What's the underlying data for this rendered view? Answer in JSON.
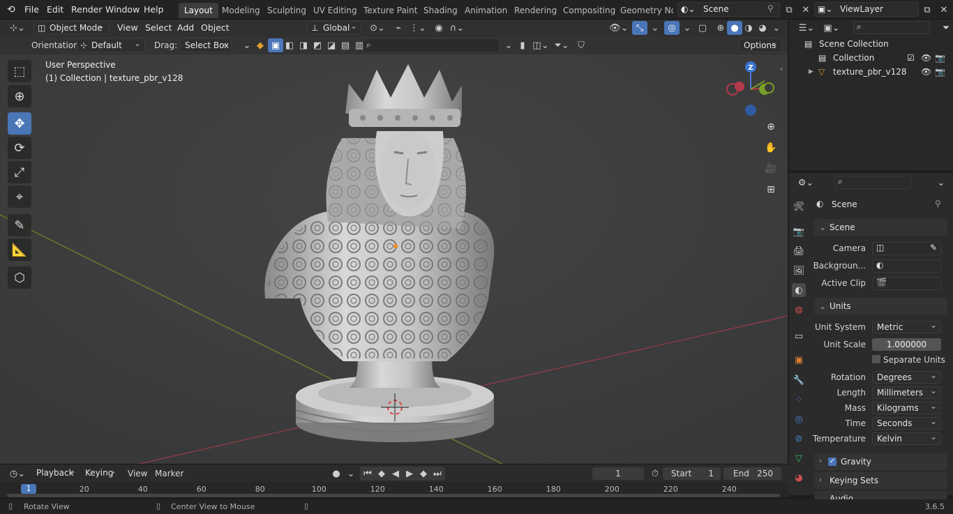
{
  "menu": {
    "items": [
      "File",
      "Edit",
      "Render",
      "Window",
      "Help"
    ],
    "workspaces": [
      "Layout",
      "Modeling",
      "Sculpting",
      "UV Editing",
      "Texture Paint",
      "Shading",
      "Animation",
      "Rendering",
      "Compositing",
      "Geometry Noc"
    ],
    "active_workspace": "Layout",
    "scene_name": "Scene",
    "view_layer": "ViewLayer"
  },
  "viewport_header": {
    "mode": "Object Mode",
    "menus": [
      "View",
      "Select",
      "Add",
      "Object"
    ],
    "transform_orientation": "Global"
  },
  "tool_settings": {
    "orientation_label": "Orientation:",
    "orientation_value": "Default",
    "drag_label": "Drag:",
    "drag_value": "Select Box",
    "options_label": "Options"
  },
  "viewport": {
    "perspective": "User Perspective",
    "collection_info": "(1) Collection | texture_pbr_v128",
    "gizmo_axis": "Z"
  },
  "outliner": {
    "root": "Scene Collection",
    "collection": "Collection",
    "object": "texture_pbr_v128"
  },
  "properties": {
    "context_title": "Scene",
    "scene_panel": {
      "title": "Scene",
      "camera_label": "Camera",
      "background_label": "Backgroun...",
      "active_clip_label": "Active Clip"
    },
    "units_panel": {
      "title": "Units",
      "unit_system_label": "Unit System",
      "unit_system": "Metric",
      "unit_scale_label": "Unit Scale",
      "unit_scale": "1.000000",
      "separate_units": "Separate Units",
      "rotation_label": "Rotation",
      "rotation": "Degrees",
      "length_label": "Length",
      "length": "Millimeters",
      "mass_label": "Mass",
      "mass": "Kilograms",
      "time_label": "Time",
      "time": "Seconds",
      "temperature_label": "Temperature",
      "temperature": "Kelvin"
    },
    "gravity": "Gravity",
    "keying_sets": "Keying Sets",
    "audio": "Audio"
  },
  "timeline": {
    "menus": [
      "Playback",
      "Keying",
      "View",
      "Marker"
    ],
    "current_frame": "1",
    "start_label": "Start",
    "start": "1",
    "end_label": "End",
    "end": "250",
    "ticks": [
      "1",
      "20",
      "40",
      "60",
      "80",
      "100",
      "120",
      "140",
      "160",
      "180",
      "200",
      "220",
      "240"
    ]
  },
  "status": {
    "left": "Rotate View",
    "middle": "Center View to Mouse",
    "version": "3.6.5"
  },
  "colors": {
    "accent": "#4a76b8",
    "x_axis": "#b33a4a",
    "y_axis": "#7a9a2a"
  }
}
